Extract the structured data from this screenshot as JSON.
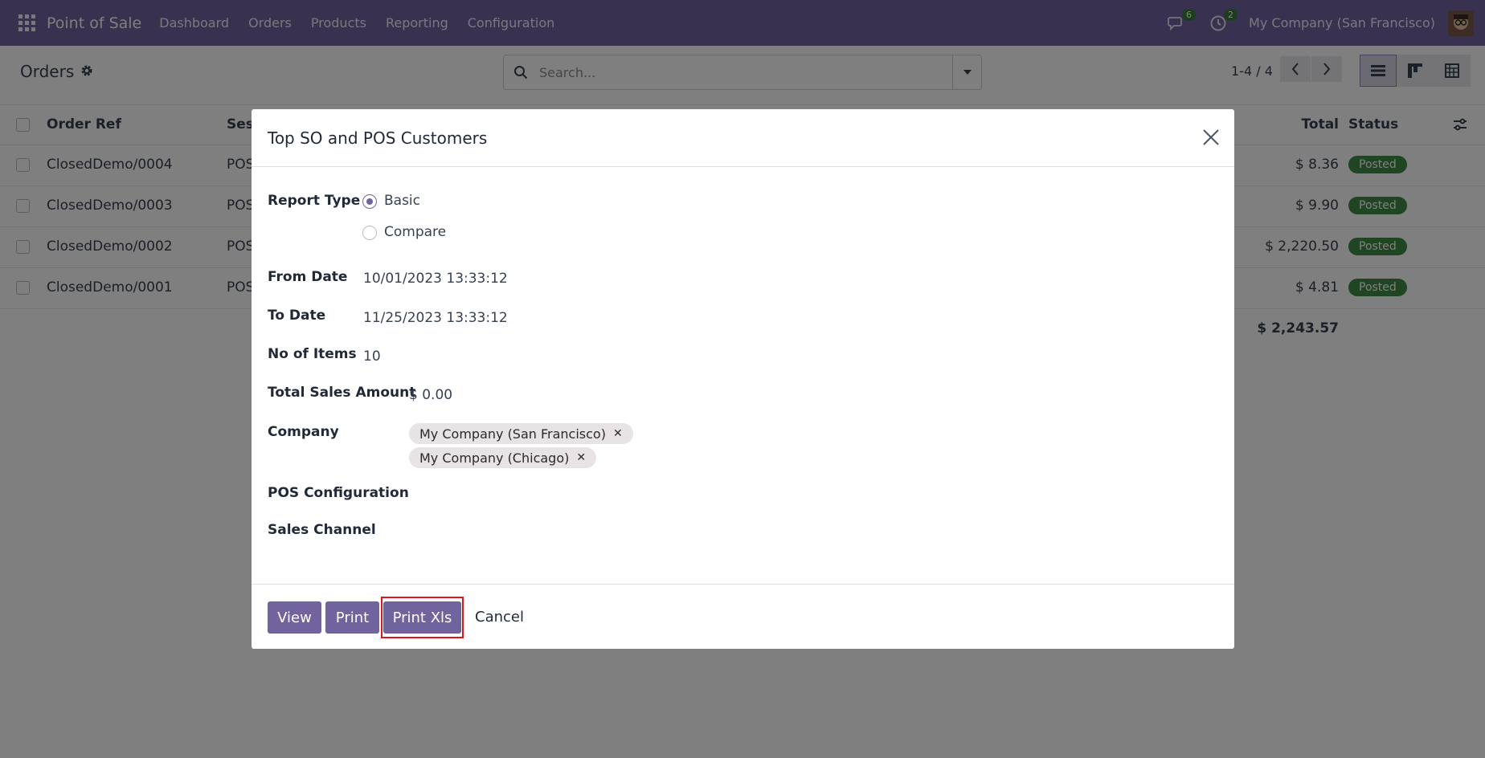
{
  "navbar": {
    "brand": "Point of Sale",
    "menu": [
      "Dashboard",
      "Orders",
      "Products",
      "Reporting",
      "Configuration"
    ],
    "messages_count": "6",
    "activities_count": "2",
    "company": "My Company (San Francisco)"
  },
  "control": {
    "title": "Orders",
    "search_placeholder": "Search...",
    "pager": "1-4 / 4"
  },
  "list": {
    "headers": {
      "ref": "Order Ref",
      "session": "Sess",
      "total": "Total",
      "status": "Status"
    },
    "rows": [
      {
        "ref": "ClosedDemo/0004",
        "session": "POS",
        "total": "$ 8.36",
        "status": "Posted"
      },
      {
        "ref": "ClosedDemo/0003",
        "session": "POS",
        "total": "$ 9.90",
        "status": "Posted"
      },
      {
        "ref": "ClosedDemo/0002",
        "session": "POS",
        "total": "$ 2,220.50",
        "status": "Posted"
      },
      {
        "ref": "ClosedDemo/0001",
        "session": "POS",
        "total": "$ 4.81",
        "status": "Posted"
      }
    ],
    "grand_total": "$ 2,243.57"
  },
  "modal": {
    "title": "Top SO and POS Customers",
    "report_type_label": "Report Type",
    "report_options": [
      "Basic",
      "Compare"
    ],
    "from_date_label": "From Date",
    "from_date": "10/01/2023 13:33:12",
    "to_date_label": "To Date",
    "to_date": "11/25/2023 13:33:12",
    "items_label": "No of Items",
    "items": "10",
    "total_sales_label": "Total Sales Amount",
    "total_sales": "$ 0.00",
    "company_label": "Company",
    "companies": [
      "My Company (San Francisco)",
      "My Company (Chicago)"
    ],
    "pos_config_label": "POS Configuration",
    "sales_channel_label": "Sales Channel",
    "buttons": {
      "view": "View",
      "print": "Print",
      "print_xls": "Print Xls",
      "cancel": "Cancel"
    }
  },
  "colors": {
    "primary": "#71639e",
    "posted": "#3f8a46",
    "highlight": "#e0151b"
  }
}
